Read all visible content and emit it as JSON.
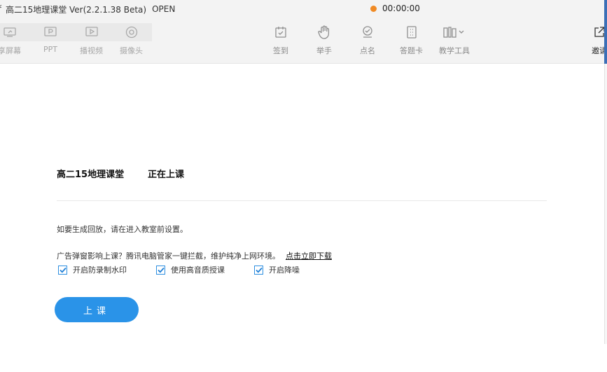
{
  "window": {
    "edge_char": "ŕ",
    "title": "高二15地理课堂 Ver(2.2.1.38 Beta)",
    "status": "OPEN",
    "timer": "00:00:00"
  },
  "toolbar": {
    "left_tools": [
      {
        "label": "享屏幕",
        "icon": "screen-share-icon"
      },
      {
        "label": "PPT",
        "icon": "ppt-icon"
      },
      {
        "label": "播视频",
        "icon": "video-play-icon"
      },
      {
        "label": "摄像头",
        "icon": "camera-icon"
      }
    ],
    "right_tools": [
      {
        "label": "签到",
        "icon": "checkin-icon"
      },
      {
        "label": "举手",
        "icon": "raise-hand-icon"
      },
      {
        "label": "点名",
        "icon": "roll-call-icon"
      },
      {
        "label": "答题卡",
        "icon": "answer-card-icon"
      },
      {
        "label": "教学工具",
        "icon": "teaching-tools-icon"
      },
      {
        "label": "邀请",
        "icon": "invite-icon"
      }
    ]
  },
  "main": {
    "class_name": "高二15地理课堂",
    "class_state": "正在上课",
    "replay_note": "如要生成回放，请在进入教室前设置。",
    "ad_text": "广告弹窗影响上课？腾讯电脑管家一键拦截，维护纯净上网环境。",
    "ad_link": "点击立即下载",
    "options": [
      {
        "label": "开启防录制水印",
        "checked": true
      },
      {
        "label": "使用高音质授课",
        "checked": true
      },
      {
        "label": "开启降噪",
        "checked": true
      }
    ],
    "start_button": "上课"
  },
  "colors": {
    "accent": "#2a93e8",
    "timer_dot": "#f08a24",
    "toolbar_bg": "#f3f3f3"
  }
}
